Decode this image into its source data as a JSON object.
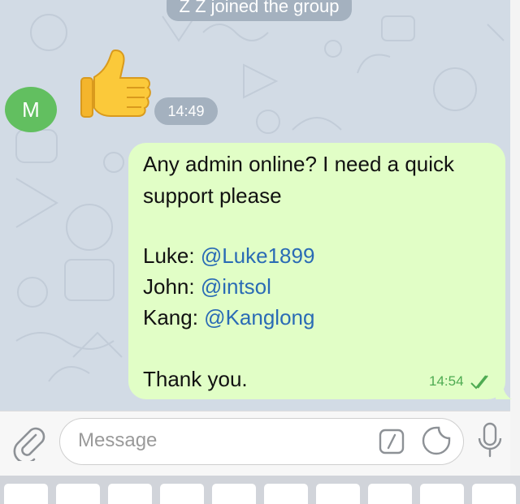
{
  "chat": {
    "service_message": "Z Z joined the group",
    "sender_initial": "M",
    "emoji_time": "14:49",
    "message": {
      "line1": "Any admin online? I need a quick",
      "line2": "support please",
      "contacts": [
        {
          "name": "Luke: ",
          "handle": "@Luke1899"
        },
        {
          "name": "John: ",
          "handle": "@intsol"
        },
        {
          "name": "Kang: ",
          "handle": "@Kanglong"
        }
      ],
      "closing": "Thank you.",
      "time": "14:54"
    }
  },
  "composer": {
    "placeholder": "Message"
  },
  "icons": {
    "attach": "paperclip-icon",
    "commands": "slash-command-icon",
    "sticker": "sticker-icon",
    "mic": "microphone-icon",
    "read_status": "double-check-icon"
  },
  "colors": {
    "chat_background": "#d2dbe5",
    "outgoing_bubble": "#e1fec6",
    "mention": "#2a6bb5",
    "avatar": "#62bf60",
    "read_check": "#4eab52"
  }
}
